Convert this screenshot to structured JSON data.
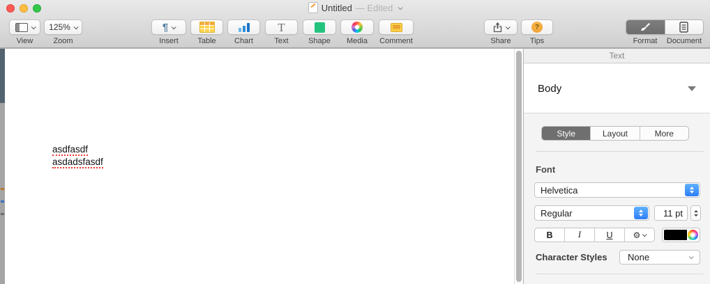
{
  "window": {
    "title": "Untitled",
    "edited_status": "— Edited"
  },
  "toolbar": {
    "view": {
      "label": "View"
    },
    "zoom": {
      "label": "Zoom",
      "value": "125%"
    },
    "insert": {
      "label": "Insert",
      "glyph": "¶"
    },
    "table": {
      "label": "Table"
    },
    "chart": {
      "label": "Chart"
    },
    "text": {
      "label": "Text",
      "glyph": "T"
    },
    "shape": {
      "label": "Shape"
    },
    "media": {
      "label": "Media"
    },
    "comment": {
      "label": "Comment"
    },
    "share": {
      "label": "Share"
    },
    "tips": {
      "label": "Tips",
      "glyph": "?"
    },
    "format": {
      "label": "Format"
    },
    "document": {
      "label": "Document"
    }
  },
  "document": {
    "lines": [
      "asdfasdf",
      "asdadsfasdf"
    ],
    "spellcheck_color": "#f0342a"
  },
  "inspector": {
    "header": "Text",
    "paragraph_style": "Body",
    "tabs": [
      {
        "label": "Style",
        "active": true
      },
      {
        "label": "Layout",
        "active": false
      },
      {
        "label": "More",
        "active": false
      }
    ],
    "font_section": {
      "title": "Font",
      "family": "Helvetica",
      "weight": "Regular",
      "size": "11 pt",
      "bold_label": "B",
      "italic_label": "I",
      "underline_label": "U",
      "gear_glyph": "⚙",
      "text_color": "#000000"
    },
    "character_styles": {
      "label": "Character Styles",
      "value": "None"
    }
  },
  "colors": {
    "accent_blue": "#2e7ef7",
    "selected_segment": "#6f6f6f",
    "traffic_red": "#fc5b57",
    "traffic_yellow": "#fdbe41",
    "traffic_green": "#34c84a"
  }
}
